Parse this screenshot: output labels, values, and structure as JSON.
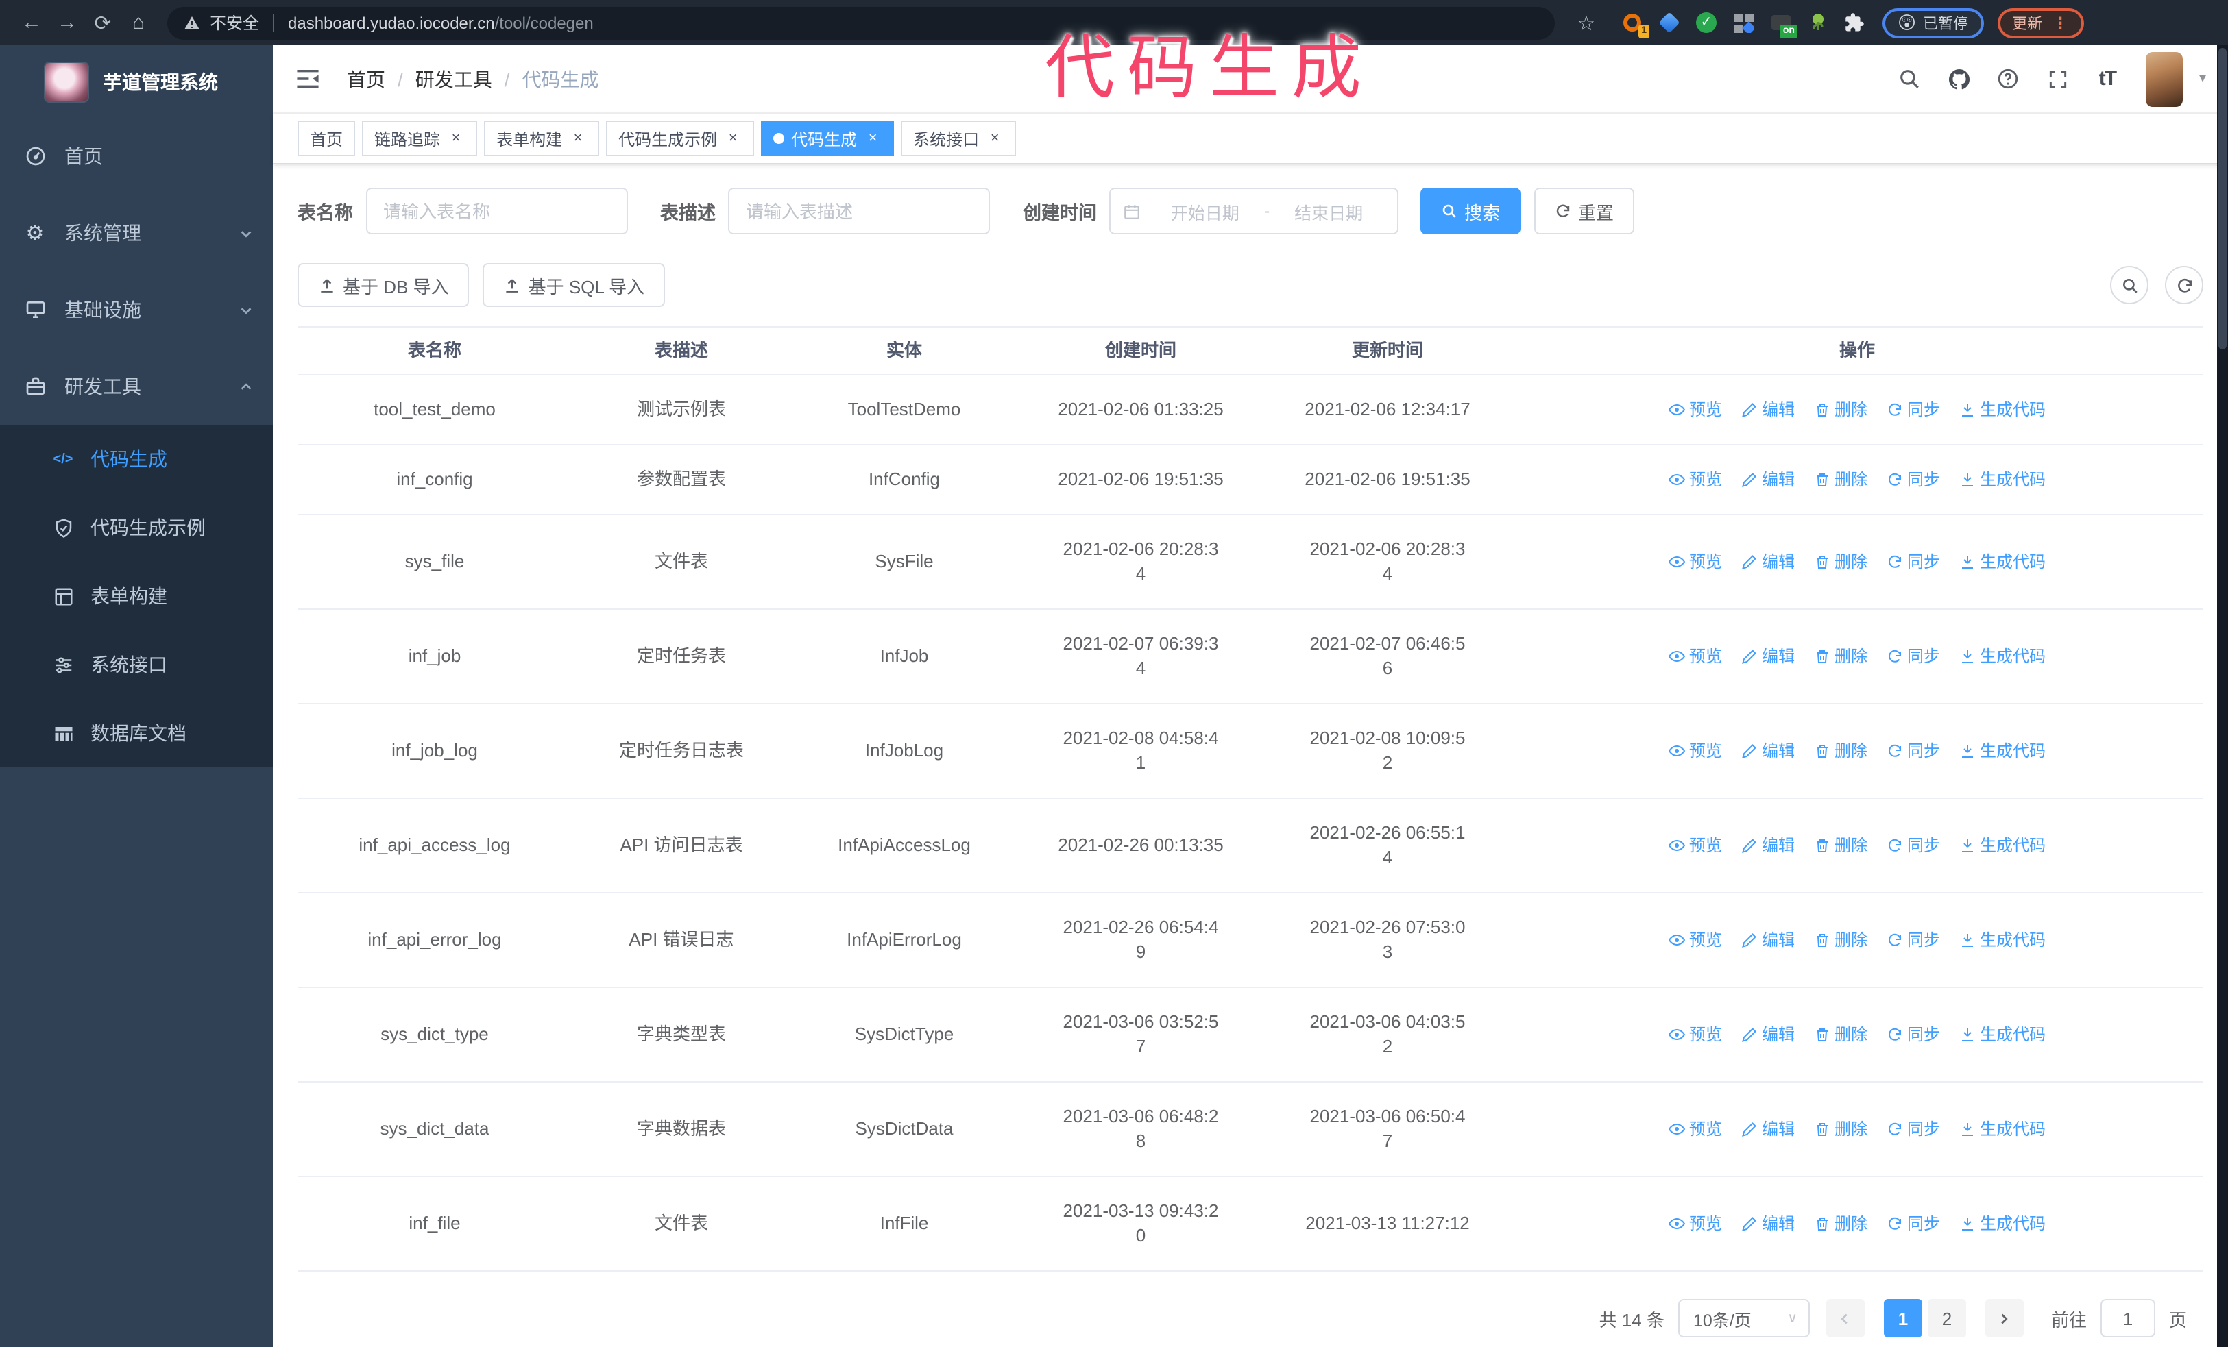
{
  "browser": {
    "security_label": "不安全",
    "url_host": "dashboard.yudao.iocoder.cn",
    "url_path": "/tool/codegen",
    "ext_badge_1": "1",
    "ext_badge_on": "on",
    "paused_pill": "已暂停",
    "paused_emoji": "😲",
    "update_label": "更新"
  },
  "overlay": {
    "text": "代码生成"
  },
  "icons": {
    "back": "←",
    "forward": "→",
    "reload": "⟳",
    "home": "⌂",
    "star": "☆",
    "menu_dots": "⋮",
    "gear": "⚙",
    "code": "</>",
    "font_size": "tT",
    "avatar_caret": "▾",
    "select_caret": "∨",
    "help_mark": "?"
  },
  "sidebar": {
    "title": "芋道管理系统",
    "items": [
      {
        "label": "首页",
        "icon": "dashboard"
      },
      {
        "label": "系统管理",
        "icon": "gear",
        "state": "collapsed"
      },
      {
        "label": "基础设施",
        "icon": "monitor",
        "state": "collapsed"
      },
      {
        "label": "研发工具",
        "icon": "toolbox",
        "state": "expanded"
      }
    ],
    "subitems": [
      {
        "label": "代码生成",
        "icon": "code",
        "active": true
      },
      {
        "label": "代码生成示例",
        "icon": "shield-check",
        "active": false
      },
      {
        "label": "表单构建",
        "icon": "form",
        "active": false
      },
      {
        "label": "系统接口",
        "icon": "sliders",
        "active": false
      },
      {
        "label": "数据库文档",
        "icon": "db-table",
        "active": false
      }
    ]
  },
  "header": {
    "breadcrumb": [
      "首页",
      "研发工具",
      "代码生成"
    ],
    "breadcrumb_separator": "/"
  },
  "tabs": [
    {
      "label": "首页",
      "closable": false,
      "active": false
    },
    {
      "label": "链路追踪",
      "closable": true,
      "active": false
    },
    {
      "label": "表单构建",
      "closable": true,
      "active": false
    },
    {
      "label": "代码生成示例",
      "closable": true,
      "active": false
    },
    {
      "label": "代码生成",
      "closable": true,
      "active": true
    },
    {
      "label": "系统接口",
      "closable": true,
      "active": false
    }
  ],
  "filters": {
    "name_label": "表名称",
    "name_placeholder": "请输入表名称",
    "desc_label": "表描述",
    "desc_placeholder": "请输入表描述",
    "time_label": "创建时间",
    "start_placeholder": "开始日期",
    "range_separator": "-",
    "end_placeholder": "结束日期",
    "search_label": "搜索",
    "reset_label": "重置"
  },
  "toolbar": {
    "import_db_label": "基于 DB 导入",
    "import_sql_label": "基于 SQL 导入"
  },
  "table": {
    "columns": [
      "表名称",
      "表描述",
      "实体",
      "创建时间",
      "更新时间",
      "操作"
    ],
    "actions": [
      "预览",
      "编辑",
      "删除",
      "同步",
      "生成代码"
    ],
    "rows": [
      {
        "name": "tool_test_demo",
        "desc": "测试示例表",
        "entity": "ToolTestDemo",
        "created": "2021-02-06 01:33:25",
        "updated": "2021-02-06 12:34:17"
      },
      {
        "name": "inf_config",
        "desc": "参数配置表",
        "entity": "InfConfig",
        "created": "2021-02-06 19:51:35",
        "updated": "2021-02-06 19:51:35"
      },
      {
        "name": "sys_file",
        "desc": "文件表",
        "entity": "SysFile",
        "created": "2021-02-06 20:28:3\n4",
        "updated": "2021-02-06 20:28:3\n4"
      },
      {
        "name": "inf_job",
        "desc": "定时任务表",
        "entity": "InfJob",
        "created": "2021-02-07 06:39:3\n4",
        "updated": "2021-02-07 06:46:5\n6"
      },
      {
        "name": "inf_job_log",
        "desc": "定时任务日志表",
        "entity": "InfJobLog",
        "created": "2021-02-08 04:58:4\n1",
        "updated": "2021-02-08 10:09:5\n2"
      },
      {
        "name": "inf_api_access_log",
        "desc": "API 访问日志表",
        "entity": "InfApiAccessLog",
        "created": "2021-02-26 00:13:35",
        "updated": "2021-02-26 06:55:1\n4"
      },
      {
        "name": "inf_api_error_log",
        "desc": "API 错误日志",
        "entity": "InfApiErrorLog",
        "created": "2021-02-26 06:54:4\n9",
        "updated": "2021-02-26 07:53:0\n3"
      },
      {
        "name": "sys_dict_type",
        "desc": "字典类型表",
        "entity": "SysDictType",
        "created": "2021-03-06 03:52:5\n7",
        "updated": "2021-03-06 04:03:5\n2"
      },
      {
        "name": "sys_dict_data",
        "desc": "字典数据表",
        "entity": "SysDictData",
        "created": "2021-03-06 06:48:2\n8",
        "updated": "2021-03-06 06:50:4\n7"
      },
      {
        "name": "inf_file",
        "desc": "文件表",
        "entity": "InfFile",
        "created": "2021-03-13 09:43:2\n0",
        "updated": "2021-03-13 11:27:12"
      }
    ]
  },
  "pagination": {
    "total_label": "共 14 条",
    "page_size_label": "10条/页",
    "pages": [
      "1",
      "2"
    ],
    "active_page": "1",
    "goto_label": "前往",
    "goto_value": "1",
    "page_unit": "页"
  },
  "colors": {
    "primary": "#409eff",
    "sidebar_bg": "#304156",
    "submenu_bg": "#1f2d3d",
    "overlay_pink": "#f4466b",
    "browser_bar_bg": "#212a34"
  }
}
